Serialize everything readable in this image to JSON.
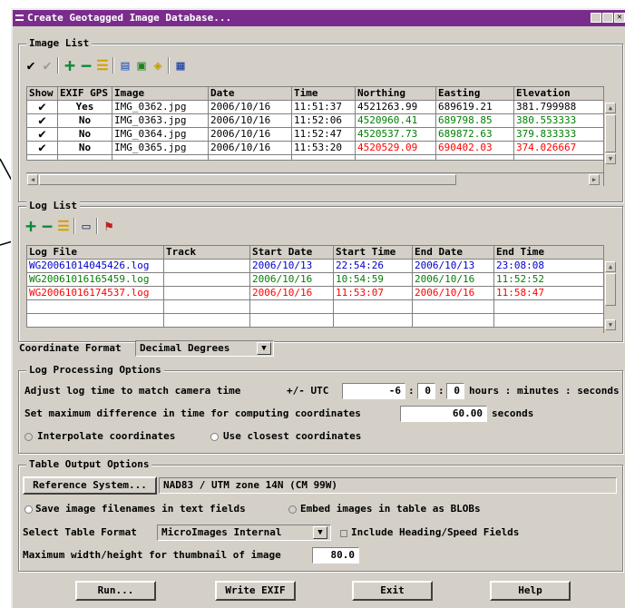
{
  "window": {
    "title": "Create Geotagged Image Database..."
  },
  "image_list": {
    "title": "Image List",
    "toolbar_icons": [
      "check-all-icon",
      "uncheck-all-icon",
      "add-icon",
      "remove-icon",
      "clear-list-icon",
      "open-folder-icon",
      "view-image-icon",
      "edit-tag-icon",
      "table-icon"
    ],
    "columns": [
      "Show",
      "EXIF GPS",
      "Image",
      "Date",
      "Time",
      "Northing",
      "Easting",
      "Elevation"
    ],
    "rows": [
      {
        "show": "✔",
        "exif": "Yes",
        "image": "IMG_0362.jpg",
        "date": "2006/10/16",
        "time": "11:51:37",
        "northing": "4521263.99",
        "easting": "689619.21",
        "elevation": "381.799988",
        "color": "#000000"
      },
      {
        "show": "✔",
        "exif": "No",
        "image": "IMG_0363.jpg",
        "date": "2006/10/16",
        "time": "11:52:06",
        "northing": "4520960.41",
        "easting": "689798.85",
        "elevation": "380.553333",
        "color": "#008000"
      },
      {
        "show": "✔",
        "exif": "No",
        "image": "IMG_0364.jpg",
        "date": "2006/10/16",
        "time": "11:52:47",
        "northing": "4520537.73",
        "easting": "689872.63",
        "elevation": "379.833333",
        "color": "#008000"
      },
      {
        "show": "✔",
        "exif": "No",
        "image": "IMG_0365.jpg",
        "date": "2006/10/16",
        "time": "11:53:20",
        "northing": "4520529.09",
        "easting": "690402.03",
        "elevation": "374.026667",
        "color": "#ff0000"
      }
    ]
  },
  "log_list": {
    "title": "Log List",
    "toolbar_icons": [
      "add-icon",
      "remove-icon",
      "clear-list-icon",
      "view-log-icon",
      "track-icon"
    ],
    "columns": [
      "Log File",
      "Track",
      "Start Date",
      "Start Time",
      "End Date",
      "End Time"
    ],
    "rows": [
      {
        "file": "WG20061014045426.log",
        "track": "",
        "start_date": "2006/10/13",
        "start_time": "22:54:26",
        "end_date": "2006/10/13",
        "end_time": "23:08:08",
        "color": "#0000cc"
      },
      {
        "file": "WG20061016165459.log",
        "track": "",
        "start_date": "2006/10/16",
        "start_time": "10:54:59",
        "end_date": "2006/10/16",
        "end_time": "11:52:52",
        "color": "#008000"
      },
      {
        "file": "WG20061016174537.log",
        "track": "",
        "start_date": "2006/10/16",
        "start_time": "11:53:07",
        "end_date": "2006/10/16",
        "end_time": "11:58:47",
        "color": "#ff0000"
      }
    ]
  },
  "coordinate_format": {
    "label": "Coordinate Format",
    "value": "Decimal Degrees"
  },
  "log_processing": {
    "title": "Log Processing Options",
    "adjust_label": "Adjust log time to match camera time",
    "utc_label": "+/- UTC",
    "hours": "-6",
    "minutes": "0",
    "seconds": "0",
    "units_label": "hours : minutes : seconds",
    "max_diff_label": "Set maximum difference in time for computing coordinates",
    "max_diff_value": "60.00",
    "max_diff_unit": "seconds",
    "interpolate_label": "Interpolate coordinates",
    "closest_label": "Use closest coordinates"
  },
  "table_output": {
    "title": "Table Output Options",
    "reference_button": "Reference System...",
    "reference_value": "NAD83 / UTM zone 14N (CM 99W)",
    "save_filenames_label": "Save image filenames in text fields",
    "embed_label": "Embed images in table as BLOBs",
    "format_label": "Select Table Format",
    "format_value": "MicroImages Internal",
    "heading_label": "Include Heading/Speed Fields",
    "thumb_label": "Maximum width/height for thumbnail of image",
    "thumb_value": "80.0"
  },
  "buttons": {
    "run": "Run...",
    "write_exif": "Write EXIF",
    "exit": "Exit",
    "help": "Help"
  }
}
